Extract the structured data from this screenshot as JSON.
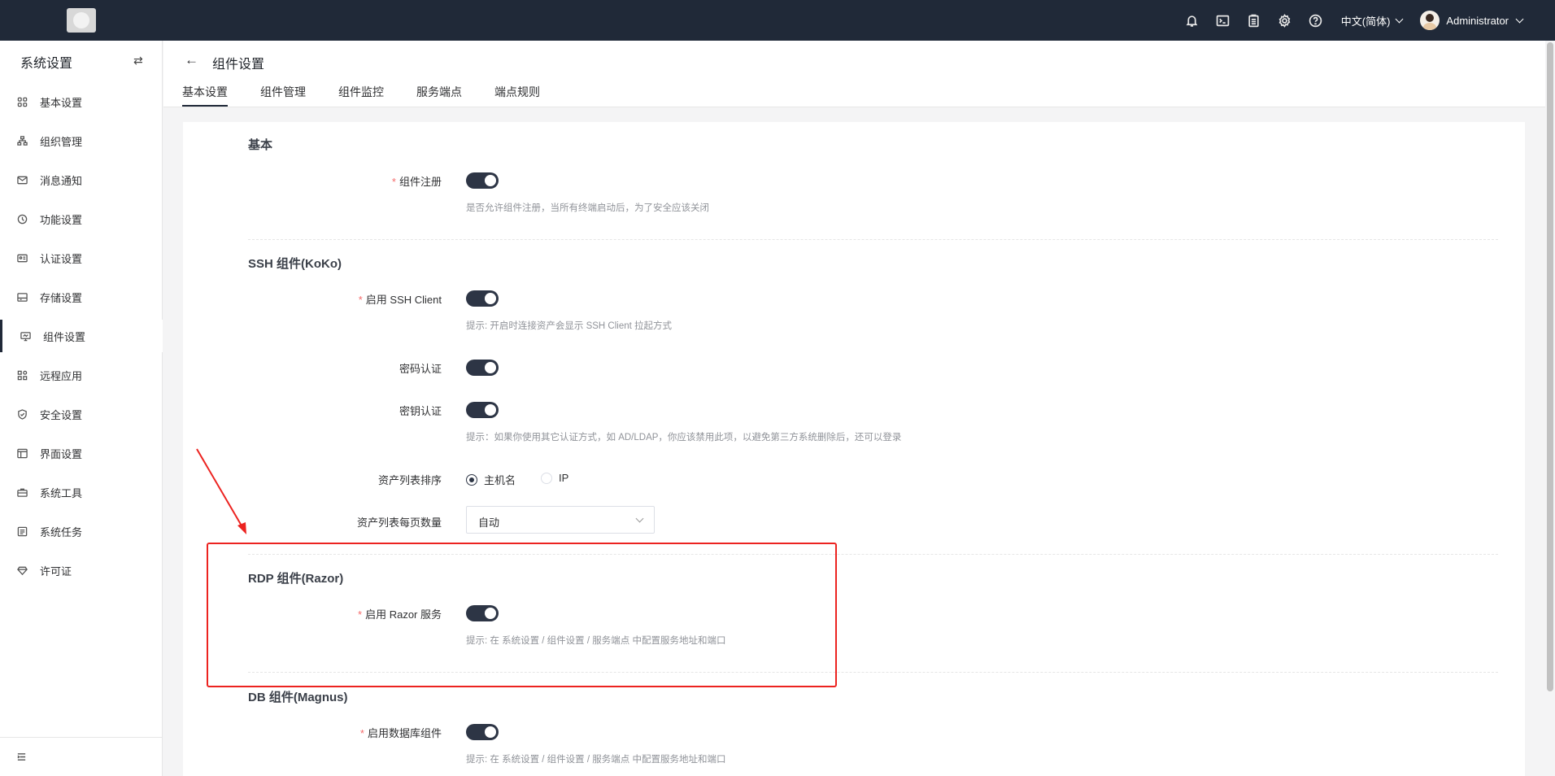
{
  "topbar": {
    "icons": [
      "bell-icon",
      "terminal-icon",
      "clipboard-icon",
      "gear-icon",
      "help-icon"
    ],
    "language": "中文(简体)",
    "username": "Administrator"
  },
  "sidebar": {
    "title": "系统设置",
    "swap_glyph": "⇄",
    "items": [
      {
        "label": "基本设置",
        "icon": "grid-icon"
      },
      {
        "label": "组织管理",
        "icon": "org-icon"
      },
      {
        "label": "消息通知",
        "icon": "message-icon"
      },
      {
        "label": "功能设置",
        "icon": "feature-icon"
      },
      {
        "label": "认证设置",
        "icon": "id-card-icon"
      },
      {
        "label": "存储设置",
        "icon": "storage-icon"
      },
      {
        "label": "组件设置",
        "icon": "monitor-icon",
        "active": true
      },
      {
        "label": "远程应用",
        "icon": "apps-icon"
      },
      {
        "label": "安全设置",
        "icon": "shield-icon"
      },
      {
        "label": "界面设置",
        "icon": "interface-icon"
      },
      {
        "label": "系统工具",
        "icon": "toolbox-icon"
      },
      {
        "label": "系统任务",
        "icon": "tasks-icon"
      },
      {
        "label": "许可证",
        "icon": "diamond-icon"
      }
    ]
  },
  "page": {
    "back_glyph": "←",
    "title": "组件设置",
    "tabs": [
      "基本设置",
      "组件管理",
      "组件监控",
      "服务端点",
      "端点规则"
    ],
    "active_tab": "基本设置"
  },
  "form": {
    "basic": {
      "title": "基本",
      "register_label": "组件注册",
      "register_on": true,
      "register_hint": "是否允许组件注册，当所有终端启动后，为了安全应该关闭"
    },
    "ssh": {
      "title": "SSH 组件(KoKo)",
      "client_label": "启用 SSH Client",
      "client_on": true,
      "client_hint": "提示: 开启时连接资产会显示 SSH Client 拉起方式",
      "password_label": "密码认证",
      "password_on": true,
      "key_label": "密钥认证",
      "key_on": true,
      "key_hint": "提示：如果你使用其它认证方式，如 AD/LDAP，你应该禁用此项，以避免第三方系统删除后，还可以登录",
      "sort_label": "资产列表排序",
      "sort_options": [
        "主机名",
        "IP"
      ],
      "sort_selected": "主机名",
      "page_size_label": "资产列表每页数量",
      "page_size_value": "自动"
    },
    "rdp": {
      "title": "RDP 组件(Razor)",
      "razor_label": "启用 Razor 服务",
      "razor_on": true,
      "razor_hint": "提示: 在 系统设置 / 组件设置 / 服务端点 中配置服务地址和端口"
    },
    "db": {
      "title": "DB 组件(Magnus)",
      "db_label": "启用数据库组件",
      "db_on": true,
      "db_hint": "提示: 在 系统设置 / 组件设置 / 服务端点 中配置服务地址和端口"
    }
  },
  "annotation": {
    "color": "#ec2320"
  }
}
